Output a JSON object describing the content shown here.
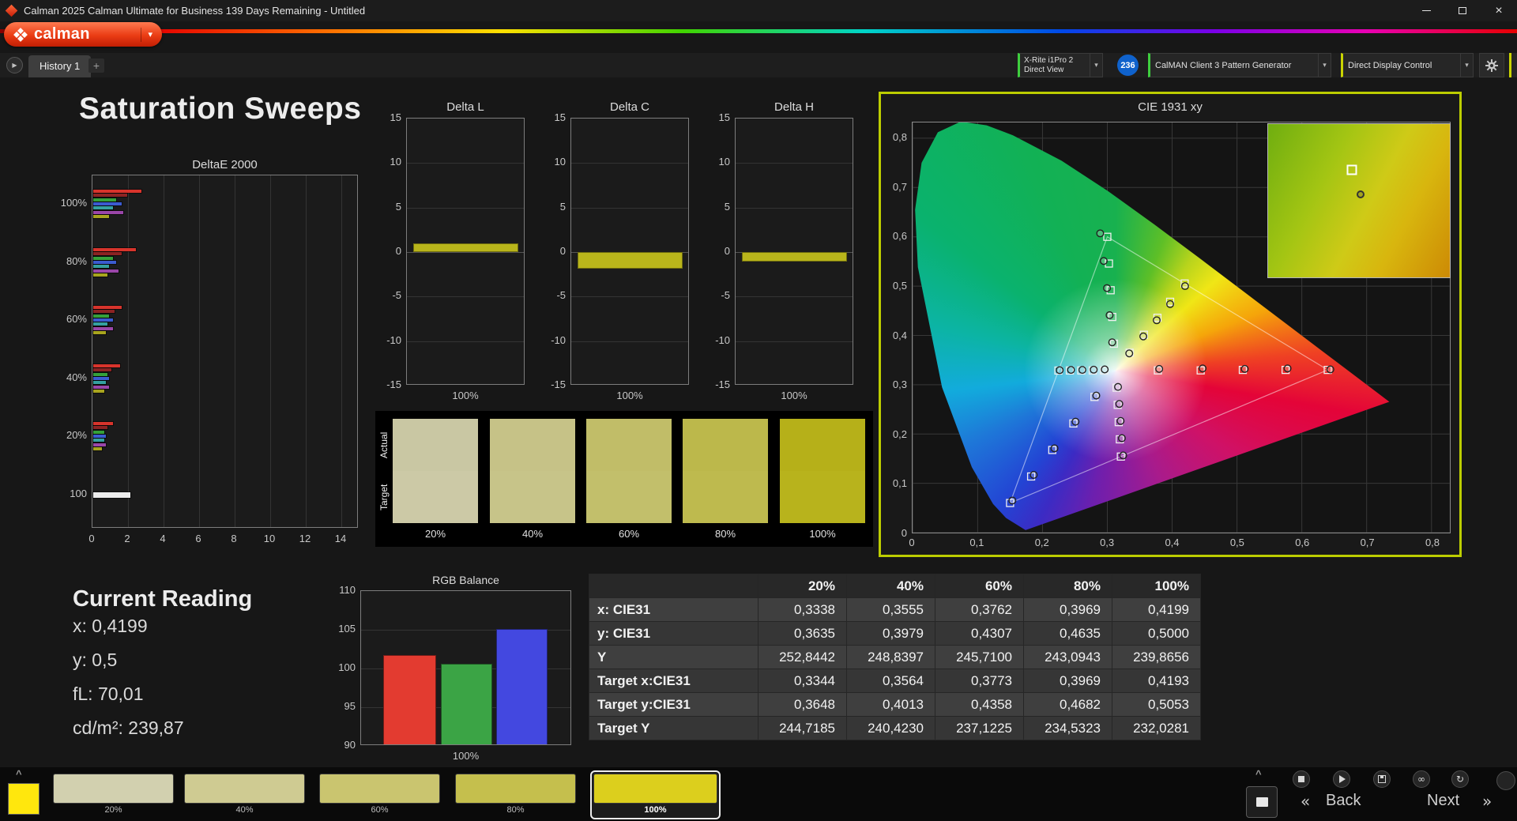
{
  "titlebar": {
    "title": "Calman 2025 Calman Ultimate for Business 139 Days Remaining  - Untitled"
  },
  "logo": {
    "brand": "calman"
  },
  "tab_bar": {
    "tabs": [
      "History 1"
    ],
    "add_label": "+"
  },
  "device_bar": {
    "meter_line1": "X-Rite i1Pro 2",
    "meter_line2": "Direct View",
    "badge": "236",
    "pattern": "CalMAN Client 3 Pattern Generator",
    "display": "Direct Display Control"
  },
  "page_title": "Saturation Sweeps",
  "deltae": {
    "title": "DeltaE 2000",
    "y_labels": [
      "100%",
      "80%",
      "60%",
      "40%",
      "20%",
      "100"
    ],
    "x_ticks": [
      0,
      2,
      4,
      6,
      8,
      10,
      12,
      14
    ],
    "x_max": 14,
    "series_colors": [
      "#d8342c",
      "#8c2323",
      "#35a03a",
      "#3b5bd0",
      "#35a0a0",
      "#9a46a8",
      "#a8a41e"
    ],
    "clusters": [
      {
        "label": "100%",
        "values": [
          2.7,
          1.9,
          1.3,
          1.6,
          1.1,
          1.7,
          0.9
        ]
      },
      {
        "label": "80%",
        "values": [
          2.4,
          1.6,
          1.1,
          1.3,
          0.9,
          1.4,
          0.8
        ]
      },
      {
        "label": "60%",
        "values": [
          1.6,
          1.2,
          0.9,
          1.1,
          0.8,
          1.1,
          0.7
        ]
      },
      {
        "label": "40%",
        "values": [
          1.5,
          1.0,
          0.8,
          0.9,
          0.7,
          0.9,
          0.6
        ]
      },
      {
        "label": "20%",
        "values": [
          1.1,
          0.8,
          0.6,
          0.7,
          0.6,
          0.7,
          0.5
        ]
      },
      {
        "label": "100",
        "values": [
          2.1
        ],
        "colors": [
          "#ececec"
        ]
      }
    ]
  },
  "delta_axis": {
    "y_labels": [
      15,
      10,
      5,
      0,
      -5,
      -10,
      -15
    ],
    "y_max": 15,
    "y_min": -15,
    "bar_color": "#b9b51b"
  },
  "delta_charts": [
    {
      "title": "Delta L",
      "value": 1.0,
      "x_label": "100%"
    },
    {
      "title": "Delta C",
      "value": -1.9,
      "x_label": "100%"
    },
    {
      "title": "Delta H",
      "value": -1.1,
      "x_label": "100%"
    }
  ],
  "swatch_panel": {
    "row_labels": [
      "Actual",
      "Target"
    ],
    "columns": [
      {
        "label": "20%",
        "actual": "#c9c7a3",
        "target": "#ccc9a6"
      },
      {
        "label": "40%",
        "actual": "#c6c287",
        "target": "#c7c489"
      },
      {
        "label": "60%",
        "actual": "#c1bd68",
        "target": "#c2bf6b"
      },
      {
        "label": "80%",
        "actual": "#bcb84b",
        "target": "#beba4e"
      },
      {
        "label": "100%",
        "actual": "#b6b019",
        "target": "#b8b31c"
      }
    ]
  },
  "cie": {
    "title": "CIE 1931 xy",
    "x_ticks": [
      "0",
      "0,1",
      "0,2",
      "0,3",
      "0,4",
      "0,5",
      "0,6",
      "0,7",
      "0,8"
    ],
    "y_ticks": [
      "0",
      "0,1",
      "0,2",
      "0,3",
      "0,4",
      "0,5",
      "0,6",
      "0,7",
      "0,8"
    ],
    "white_point_pct": [
      37.8,
      60.5
    ],
    "conic_stops": [
      [
        "#18b14f",
        0
      ],
      [
        "#5ebf27",
        20
      ],
      [
        "#b8d41c",
        34
      ],
      [
        "#f0e616",
        48
      ],
      [
        "#f5a50a",
        68
      ],
      [
        "#ef4123",
        85
      ],
      [
        "#e40438",
        100
      ],
      [
        "#d01166",
        125
      ],
      [
        "#a81b8c",
        158
      ],
      [
        "#6d1fae",
        190
      ],
      [
        "#3b2bc4",
        207
      ],
      [
        "#2344d4",
        220
      ],
      [
        "#1e78d8",
        244
      ],
      [
        "#12abdc",
        263
      ],
      [
        "#0cb4a4",
        284
      ],
      [
        "#0ab26e",
        308
      ],
      [
        "#12b155",
        338
      ],
      [
        "#18b14f",
        360
      ]
    ],
    "horseshoe_pct": [
      [
        21.03,
        99.4
      ],
      [
        17.39,
        96.43
      ],
      [
        14.99,
        93.05
      ],
      [
        11.03,
        84.05
      ],
      [
        5.48,
        64.54
      ],
      [
        0.99,
        35.28
      ],
      [
        0.47,
        21.29
      ],
      [
        1.68,
        9.82
      ],
      [
        4.7,
        2.39
      ],
      [
        8.97,
        -0.22
      ],
      [
        13.79,
        0.69
      ],
      [
        18.68,
        3.13
      ],
      [
        27.73,
        9.33
      ],
      [
        36.43,
        16.78
      ],
      [
        45.06,
        24.93
      ],
      [
        53.64,
        33.32
      ],
      [
        61.9,
        41.51
      ],
      [
        69.47,
        49.01
      ],
      [
        75.73,
        55.22
      ],
      [
        80.41,
        59.85
      ],
      [
        83.52,
        62.94
      ],
      [
        86.24,
        65.64
      ],
      [
        88.73,
        68.11
      ]
    ],
    "gamut_triangle": [
      [
        0.64,
        0.33
      ],
      [
        0.3,
        0.6
      ],
      [
        0.15,
        0.06
      ]
    ],
    "sweeps": [
      {
        "name": "red",
        "targets": [
          [
            0.378,
            0.329
          ],
          [
            0.444,
            0.329
          ],
          [
            0.509,
            0.33
          ],
          [
            0.575,
            0.33
          ],
          [
            0.64,
            0.33
          ]
        ],
        "measured": [
          [
            0.38,
            0.332
          ],
          [
            0.447,
            0.333
          ],
          [
            0.512,
            0.332
          ],
          [
            0.578,
            0.333
          ],
          [
            0.644,
            0.331
          ]
        ]
      },
      {
        "name": "green",
        "targets": [
          [
            0.3102,
            0.3832
          ],
          [
            0.3076,
            0.4374
          ],
          [
            0.3051,
            0.4916
          ],
          [
            0.3025,
            0.5458
          ],
          [
            0.3,
            0.6
          ]
        ],
        "measured": [
          [
            0.3075,
            0.386
          ],
          [
            0.3035,
            0.441
          ],
          [
            0.2995,
            0.496
          ],
          [
            0.2945,
            0.551
          ],
          [
            0.289,
            0.607
          ]
        ]
      },
      {
        "name": "blue",
        "targets": [
          [
            0.2802,
            0.2752
          ],
          [
            0.2476,
            0.2214
          ],
          [
            0.2151,
            0.1676
          ],
          [
            0.1825,
            0.1138
          ],
          [
            0.15,
            0.06
          ]
        ],
        "measured": [
          [
            0.283,
            0.278
          ],
          [
            0.251,
            0.225
          ],
          [
            0.2185,
            0.171
          ],
          [
            0.1865,
            0.117
          ],
          [
            0.1535,
            0.065
          ]
        ]
      },
      {
        "name": "cyan",
        "targets": [
          [
            0.2951,
            0.329
          ],
          [
            0.2775,
            0.3289
          ],
          [
            0.2598,
            0.3289
          ],
          [
            0.2422,
            0.3288
          ],
          [
            0.2246,
            0.3287
          ]
        ],
        "measured": [
          [
            0.296,
            0.331
          ],
          [
            0.279,
            0.3305
          ],
          [
            0.2615,
            0.33
          ],
          [
            0.244,
            0.33
          ],
          [
            0.2265,
            0.3295
          ]
        ]
      },
      {
        "name": "magenta",
        "targets": [
          [
            0.3143,
            0.294
          ],
          [
            0.316,
            0.2591
          ],
          [
            0.3176,
            0.2241
          ],
          [
            0.3193,
            0.1892
          ],
          [
            0.3209,
            0.1542
          ]
        ],
        "measured": [
          [
            0.3165,
            0.2955
          ],
          [
            0.3185,
            0.261
          ],
          [
            0.3205,
            0.2265
          ],
          [
            0.3225,
            0.1915
          ],
          [
            0.3245,
            0.1565
          ]
        ]
      },
      {
        "name": "yellow",
        "targets": [
          [
            0.3344,
            0.3648
          ],
          [
            0.3564,
            0.4013
          ],
          [
            0.3773,
            0.4358
          ],
          [
            0.3969,
            0.4682
          ],
          [
            0.4193,
            0.5053
          ]
        ],
        "measured": [
          [
            0.3338,
            0.3635
          ],
          [
            0.3555,
            0.3979
          ],
          [
            0.3762,
            0.4307
          ],
          [
            0.3969,
            0.4635
          ],
          [
            0.4199,
            0.5
          ]
        ]
      }
    ],
    "inset": {
      "square_pct": [
        46,
        30
      ],
      "circle_pct": [
        51,
        46
      ]
    }
  },
  "current_reading": {
    "title": "Current Reading",
    "lines": [
      {
        "label": "x:",
        "value": "0,4199"
      },
      {
        "label": "y:",
        "value": "0,5"
      },
      {
        "label": "fL:",
        "value": "70,01"
      },
      {
        "label": "cd/m²:",
        "value": "239,87"
      }
    ]
  },
  "rgb_balance": {
    "title": "RGB Balance",
    "y_labels": [
      110,
      105,
      100,
      95,
      90
    ],
    "y_min": 90,
    "y_max": 110,
    "bars": [
      {
        "name": "red",
        "color": "#e33b30",
        "value": 101.5
      },
      {
        "name": "green",
        "color": "#3ba445",
        "value": 100.4
      },
      {
        "name": "blue",
        "color": "#4348e0",
        "value": 104.9
      }
    ],
    "x_label": "100%"
  },
  "results_table": {
    "headers": [
      "",
      "20%",
      "40%",
      "60%",
      "80%",
      "100%"
    ],
    "rows": [
      {
        "label": "x: CIE31",
        "values": [
          "0,3338",
          "0,3555",
          "0,3762",
          "0,3969",
          "0,4199"
        ]
      },
      {
        "label": "y: CIE31",
        "values": [
          "0,3635",
          "0,3979",
          "0,4307",
          "0,4635",
          "0,5000"
        ]
      },
      {
        "label": "Y",
        "values": [
          "252,8442",
          "248,8397",
          "245,7100",
          "243,0943",
          "239,8656"
        ]
      },
      {
        "label": "Target x:CIE31",
        "values": [
          "0,3344",
          "0,3564",
          "0,3773",
          "0,3969",
          "0,4193"
        ]
      },
      {
        "label": "Target y:CIE31",
        "values": [
          "0,3648",
          "0,4013",
          "0,4358",
          "0,4682",
          "0,5053"
        ]
      },
      {
        "label": "Target Y",
        "values": [
          "244,7185",
          "240,4230",
          "237,1225",
          "234,5323",
          "232,0281"
        ]
      }
    ]
  },
  "bottom_bar": {
    "patch_color": "#ffe70d",
    "swatches": [
      {
        "label": "20%",
        "color": "#d2d0af"
      },
      {
        "label": "40%",
        "color": "#cfcb92"
      },
      {
        "label": "60%",
        "color": "#cac56f"
      },
      {
        "label": "80%",
        "color": "#c5bf4d"
      },
      {
        "label": "100%",
        "color": "#dccf1d",
        "selected": true
      }
    ],
    "back": "Back",
    "next": "Next"
  }
}
